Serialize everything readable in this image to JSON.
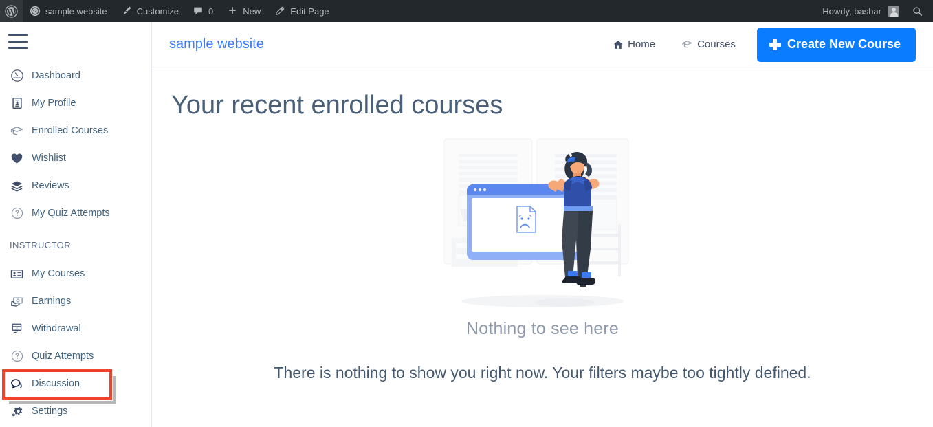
{
  "adminbar": {
    "items": [
      {
        "name": "wordpress-logo",
        "icon": "wordpress-icon",
        "label": ""
      },
      {
        "name": "site-name",
        "icon": "dashboard-icon",
        "label": "sample website"
      },
      {
        "name": "customize",
        "icon": "brush-icon",
        "label": "Customize"
      },
      {
        "name": "comments",
        "icon": "comment-icon",
        "label": "0"
      },
      {
        "name": "new-content",
        "icon": "plus-icon",
        "label": "New"
      },
      {
        "name": "edit-page",
        "icon": "pencil-icon",
        "label": "Edit Page"
      }
    ],
    "howdy": "Howdy, bashar",
    "search_icon": "search-icon",
    "bg_color": "#23282d",
    "text_color": "#b4b9be"
  },
  "sidebar": {
    "menu_icon": "hamburger-icon",
    "items": [
      {
        "label": "Dashboard",
        "icon": "speedometer-icon"
      },
      {
        "label": "My Profile",
        "icon": "id-card-icon"
      },
      {
        "label": "Enrolled Courses",
        "icon": "graduation-cap-icon"
      },
      {
        "label": "Wishlist",
        "icon": "heart-icon"
      },
      {
        "label": "Reviews",
        "icon": "layers-icon"
      },
      {
        "label": "My Quiz Attempts",
        "icon": "question-circle-icon"
      }
    ],
    "section_label": "INSTRUCTOR",
    "instructor_items": [
      {
        "label": "My Courses",
        "icon": "course-card-icon"
      },
      {
        "label": "Earnings",
        "icon": "money-hand-icon"
      },
      {
        "label": "Withdrawal",
        "icon": "withdraw-icon"
      },
      {
        "label": "Quiz Attempts",
        "icon": "question-circle-icon",
        "highlighted": true
      },
      {
        "label": "Discussion",
        "icon": "chat-bubble-icon"
      },
      {
        "label": "Settings",
        "icon": "gear-icon"
      }
    ],
    "highlight_color": "#f0432c"
  },
  "header": {
    "site_title": "sample website",
    "site_title_color": "#3a7bf5",
    "nav": [
      {
        "label": "Home",
        "icon": "home-icon"
      },
      {
        "label": "Courses",
        "icon": "graduation-cap-icon"
      }
    ],
    "cta": {
      "label": "Create New Course",
      "icon": "plus-icon",
      "color": "#0a7cff"
    }
  },
  "main": {
    "page_title": "Your recent enrolled courses",
    "empty_state": {
      "illustration": "woman-with-browser-window-sad-face-illustration",
      "title": "Nothing to see here",
      "description": "There is nothing to show you right now. Your filters maybe too tightly defined."
    }
  }
}
